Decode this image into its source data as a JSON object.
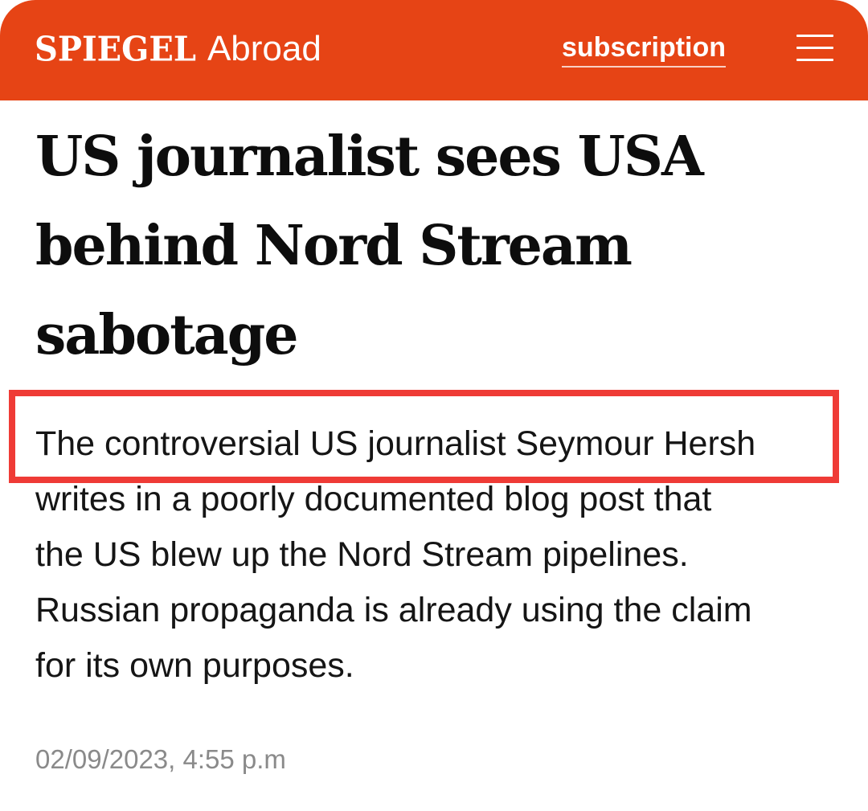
{
  "header": {
    "brand": "SPIEGEL",
    "section": "Abroad",
    "subscription_label": "subscription",
    "menu_icon": "hamburger-menu-icon",
    "background_color": "#e64415"
  },
  "article": {
    "headline_lines": [
      "US journalist sees USA",
      "behind Nord Stream",
      "sabotage"
    ],
    "teaser_lines": [
      "The controversial US journalist Seymour Hersh",
      "writes in a poorly documented blog post that",
      "the US blew up the Nord Stream pipelines.",
      "Russian propaganda is already using the claim",
      "for its own purposes."
    ],
    "timestamp": "02/09/2023, 4:55 p.m"
  },
  "annotation": {
    "highlight_color": "#ef3b36"
  }
}
